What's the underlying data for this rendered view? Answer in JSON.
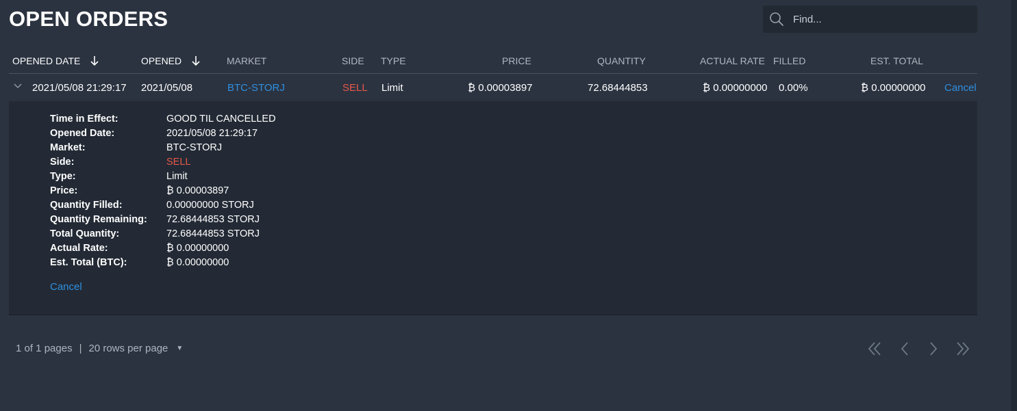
{
  "page": {
    "title": "OPEN ORDERS"
  },
  "search": {
    "placeholder": "Find..."
  },
  "columns": {
    "opened_date": "OPENED DATE",
    "opened": "OPENED",
    "market": "MARKET",
    "side": "SIDE",
    "type": "TYPE",
    "price": "PRICE",
    "quantity": "QUANTITY",
    "actual_rate": "ACTUAL RATE",
    "filled": "FILLED",
    "est_total": "EST. TOTAL"
  },
  "order": {
    "opened_date": "2021/05/08 21:29:17",
    "opened": "2021/05/08",
    "market": "BTC-STORJ",
    "side": "SELL",
    "type": "Limit",
    "price": "₿ 0.00003897",
    "quantity": "72.68444853",
    "actual_rate": "₿ 0.00000000",
    "filled": "0.00%",
    "est_total": "₿ 0.00000000",
    "cancel_label": "Cancel"
  },
  "details": {
    "rows": [
      {
        "label": "Time in Effect:",
        "value": "GOOD TIL CANCELLED"
      },
      {
        "label": "Opened Date:",
        "value": "2021/05/08 21:29:17"
      },
      {
        "label": "Market:",
        "value": "BTC-STORJ"
      },
      {
        "label": "Side:",
        "value": "SELL"
      },
      {
        "label": "Type:",
        "value": "Limit"
      },
      {
        "label": "Price:",
        "value": "₿ 0.00003897"
      },
      {
        "label": "Quantity Filled:",
        "value": "0.00000000 STORJ"
      },
      {
        "label": "Quantity Remaining:",
        "value": "72.68444853 STORJ"
      },
      {
        "label": "Total Quantity:",
        "value": "72.68444853 STORJ"
      },
      {
        "label": "Actual Rate:",
        "value": "₿ 0.00000000"
      },
      {
        "label": "Est. Total (BTC):",
        "value": "₿ 0.00000000"
      }
    ],
    "cancel_label": "Cancel"
  },
  "footer": {
    "pages_text": "1 of 1 pages",
    "separator": "|",
    "rows_per_page": "20 rows per page"
  },
  "pagination": {
    "first_icon": "double-chevron-left-icon",
    "prev_icon": "chevron-left-icon",
    "next_icon": "chevron-right-icon",
    "last_icon": "double-chevron-right-icon"
  },
  "colors": {
    "background": "#2b3340",
    "detail_background": "#232a35",
    "link": "#2f8fe0",
    "sell": "#e8574a",
    "muted_text": "#b0b7c1"
  }
}
